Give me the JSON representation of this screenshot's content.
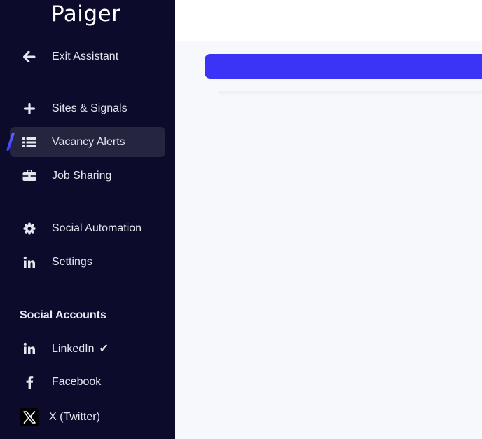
{
  "brand": {
    "logo_text": "Paiger"
  },
  "sidebar": {
    "exit_label": "Exit Assistant",
    "items": [
      {
        "label": "Sites & Signals",
        "icon": "plus-icon"
      },
      {
        "label": "Vacancy Alerts",
        "icon": "list-icon",
        "active": true
      },
      {
        "label": "Job Sharing",
        "icon": "briefcase-icon"
      },
      {
        "label": "Social Automation",
        "icon": "gear-icon"
      },
      {
        "label": "Settings",
        "icon": "linkedin-icon"
      }
    ],
    "social_title": "Social Accounts",
    "social": [
      {
        "label": "LinkedIn",
        "icon": "linkedin-icon",
        "check": "✔"
      },
      {
        "label": "Facebook",
        "icon": "facebook-icon"
      },
      {
        "label": "X (Twitter)",
        "icon": "x-icon"
      }
    ]
  },
  "colors": {
    "sidebar_bg": "#0c0b2b",
    "active_bg": "#25253f",
    "accent": "#3b33f5"
  }
}
